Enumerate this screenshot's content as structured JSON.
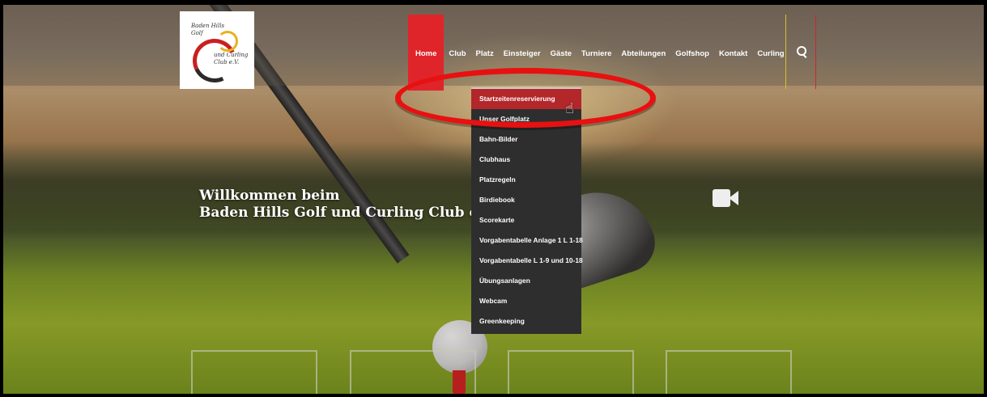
{
  "logo": {
    "text_line1": "Baden Hills",
    "text_line2": "Golf",
    "text_line3": "und Curling",
    "text_line4": "Club e.V."
  },
  "nav": {
    "items": [
      "Home",
      "Club",
      "Platz",
      "Einsteiger",
      "Gäste",
      "Turniere",
      "Abteilungen",
      "Golfshop",
      "Kontakt",
      "Curling"
    ],
    "active": "Home"
  },
  "dropdown": {
    "items": [
      "Startzeitenreservierung",
      "Unser Golfplatz",
      "Bahn-Bilder",
      "Clubhaus",
      "Platzregeln",
      "Birdiebook",
      "Scorekarte",
      "Vorgabentabelle Anlage 1 L 1-18",
      "Vorgabentabelle L 1-9 und 10-18",
      "Übungsanlagen",
      "Webcam",
      "Greenkeeping"
    ],
    "highlighted": "Startzeitenreservierung"
  },
  "hero": {
    "line1": "Willkommen beim",
    "line2": "Baden Hills Golf und Curling Club e"
  },
  "colors": {
    "accent": "#e0252a",
    "dropdown_bg": "#2e2e2e",
    "highlight_ellipse": "#e81010"
  }
}
